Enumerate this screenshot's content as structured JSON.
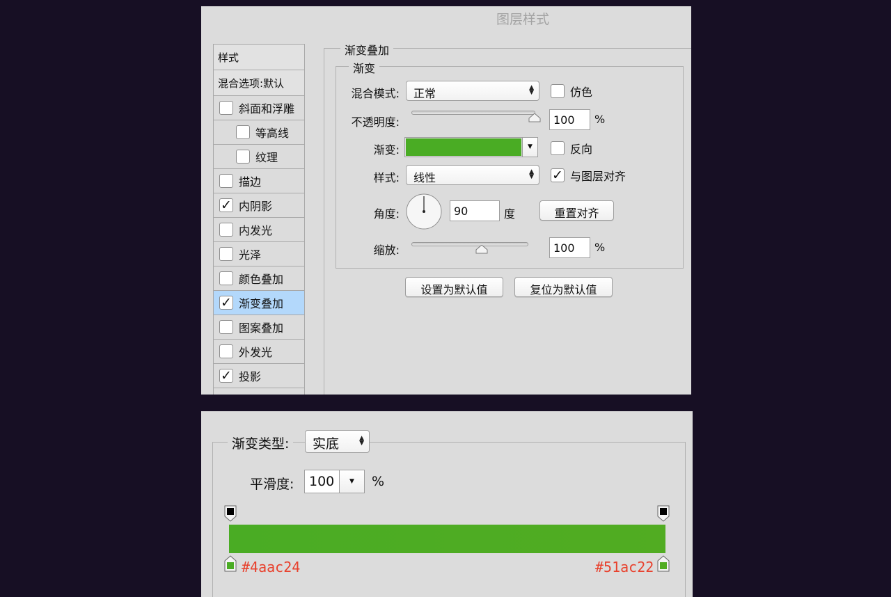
{
  "top": {
    "title": "图层样式",
    "list_header": "样式",
    "list_blend": "混合选项:默认",
    "list_items": [
      {
        "label": "斜面和浮雕",
        "checked": false,
        "indent": false,
        "active": false
      },
      {
        "label": "等高线",
        "checked": false,
        "indent": true,
        "active": false
      },
      {
        "label": "纹理",
        "checked": false,
        "indent": true,
        "active": false
      },
      {
        "label": "描边",
        "checked": false,
        "indent": false,
        "active": false
      },
      {
        "label": "内阴影",
        "checked": true,
        "indent": false,
        "active": false
      },
      {
        "label": "内发光",
        "checked": false,
        "indent": false,
        "active": false
      },
      {
        "label": "光泽",
        "checked": false,
        "indent": false,
        "active": false
      },
      {
        "label": "颜色叠加",
        "checked": false,
        "indent": false,
        "active": false
      },
      {
        "label": "渐变叠加",
        "checked": true,
        "indent": false,
        "active": true
      },
      {
        "label": "图案叠加",
        "checked": false,
        "indent": false,
        "active": false
      },
      {
        "label": "外发光",
        "checked": false,
        "indent": false,
        "active": false
      },
      {
        "label": "投影",
        "checked": true,
        "indent": false,
        "active": false
      }
    ],
    "section_title": "渐变叠加",
    "group_title": "渐变",
    "blend_mode_label": "混合模式:",
    "blend_mode_value": "正常",
    "dither_label": "仿色",
    "dither_checked": false,
    "opacity_label": "不透明度:",
    "opacity_value": "100",
    "opacity_level": 1.0,
    "percent": "%",
    "gradient_label": "渐变:",
    "gradient_color": "#4aac24",
    "reverse_label": "反向",
    "reverse_checked": false,
    "style_label": "样式:",
    "style_value": "线性",
    "align_label": "与图层对齐",
    "align_checked": true,
    "angle_label": "角度:",
    "angle_value": "90",
    "degree_unit": "度",
    "reset_align_button": "重置对齐",
    "scale_label": "缩放:",
    "scale_value": "100",
    "scale_level": 0.6,
    "set_default_button": "设置为默认值",
    "reset_default_button": "复位为默认值"
  },
  "bottom": {
    "gradient_type_label": "渐变类型:",
    "gradient_type_value": "实底",
    "smoothness_label": "平滑度:",
    "smoothness_value": "100",
    "percent": "%",
    "left_color": "#4aac24",
    "right_color": "#51ac22",
    "left_hex": "#4aac24",
    "right_hex": "#51ac22",
    "hex_color": "#e8402c"
  }
}
